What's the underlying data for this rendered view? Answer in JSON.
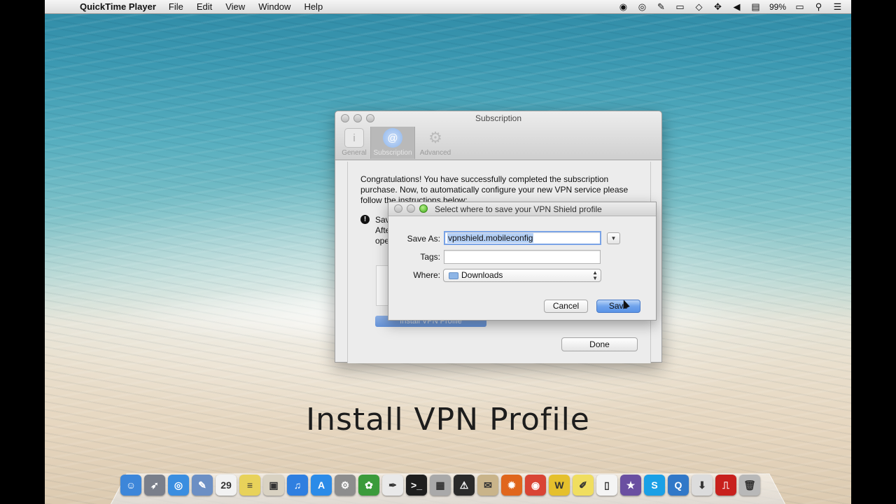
{
  "menubar": {
    "app_name": "QuickTime Player",
    "items": [
      "File",
      "Edit",
      "View",
      "Window",
      "Help"
    ],
    "battery": "99%"
  },
  "subscription_window": {
    "title": "Subscription",
    "toolbar": [
      {
        "label": "General",
        "icon": "general-icon"
      },
      {
        "label": "Subscription",
        "icon": "at-sign-icon"
      },
      {
        "label": "Advanced",
        "icon": "gear-icon"
      }
    ],
    "message": "Congratulations! You have successfully completed the subscription purchase. Now, to automatically configure your new VPN service please follow the instructions below:",
    "fragments": [
      "Sav",
      "Afte",
      "ope"
    ],
    "install_button": "Install VPN Profile",
    "done_button": "Done"
  },
  "save_sheet": {
    "title": "Select where to save your VPN Shield profile",
    "save_as_label": "Save As:",
    "save_as_value": "vpnshield.mobileconfig",
    "tags_label": "Tags:",
    "tags_value": "",
    "where_label": "Where:",
    "where_value": "Downloads",
    "cancel_button": "Cancel",
    "save_button": "Save"
  },
  "caption": "Install VPN Profile",
  "dock": [
    {
      "name": "finder-icon",
      "color": "#3d86d9",
      "glyph": "☺"
    },
    {
      "name": "launchpad-icon",
      "color": "#7a7f8a",
      "glyph": "➶"
    },
    {
      "name": "safari-icon",
      "color": "#3a8ee0",
      "glyph": "◎"
    },
    {
      "name": "preview-icon",
      "color": "#6c8fc4",
      "glyph": "✎"
    },
    {
      "name": "calendar-icon",
      "color": "#f2f2f2",
      "glyph": "29"
    },
    {
      "name": "notes-icon",
      "color": "#e8d25a",
      "glyph": "≡"
    },
    {
      "name": "photos-icon",
      "color": "#d9d2c2",
      "glyph": "▣"
    },
    {
      "name": "itunes-icon",
      "color": "#2f7fe0",
      "glyph": "♫"
    },
    {
      "name": "app-store-icon",
      "color": "#2b8be8",
      "glyph": "A"
    },
    {
      "name": "system-preferences-icon",
      "color": "#8d8d8d",
      "glyph": "⚙"
    },
    {
      "name": "evernote-icon",
      "color": "#3b9b3b",
      "glyph": "✿"
    },
    {
      "name": "textedit-icon",
      "color": "#e9e9e9",
      "glyph": "✒"
    },
    {
      "name": "terminal-icon",
      "color": "#1e1e1e",
      "glyph": ">_"
    },
    {
      "name": "calculator-icon",
      "color": "#a9a9a9",
      "glyph": "▦"
    },
    {
      "name": "console-icon",
      "color": "#2a2a2a",
      "glyph": "⚠"
    },
    {
      "name": "mail-icon",
      "color": "#c9b48a",
      "glyph": "✉"
    },
    {
      "name": "firefox-icon",
      "color": "#e0661c",
      "glyph": "✹"
    },
    {
      "name": "chrome-icon",
      "color": "#d94434",
      "glyph": "◉"
    },
    {
      "name": "wunderlist-icon",
      "color": "#e5c02c",
      "glyph": "W"
    },
    {
      "name": "stickies-icon",
      "color": "#f0de5f",
      "glyph": "✐"
    },
    {
      "name": "document-icon",
      "color": "#f4f4f4",
      "glyph": "▯"
    },
    {
      "name": "imovie-icon",
      "color": "#6a4fa1",
      "glyph": "★"
    },
    {
      "name": "skype-icon",
      "color": "#1aa0e6",
      "glyph": "S"
    },
    {
      "name": "quicktime-icon",
      "color": "#3178c8",
      "glyph": "Q"
    },
    {
      "name": "downloads-folder-icon",
      "color": "#dcdcdc",
      "glyph": "⬇"
    },
    {
      "name": "acrobat-icon",
      "color": "#c8201c",
      "glyph": "⎍"
    },
    {
      "name": "trash-icon",
      "color": "#b8b8b8",
      "glyph": "🗑"
    }
  ]
}
